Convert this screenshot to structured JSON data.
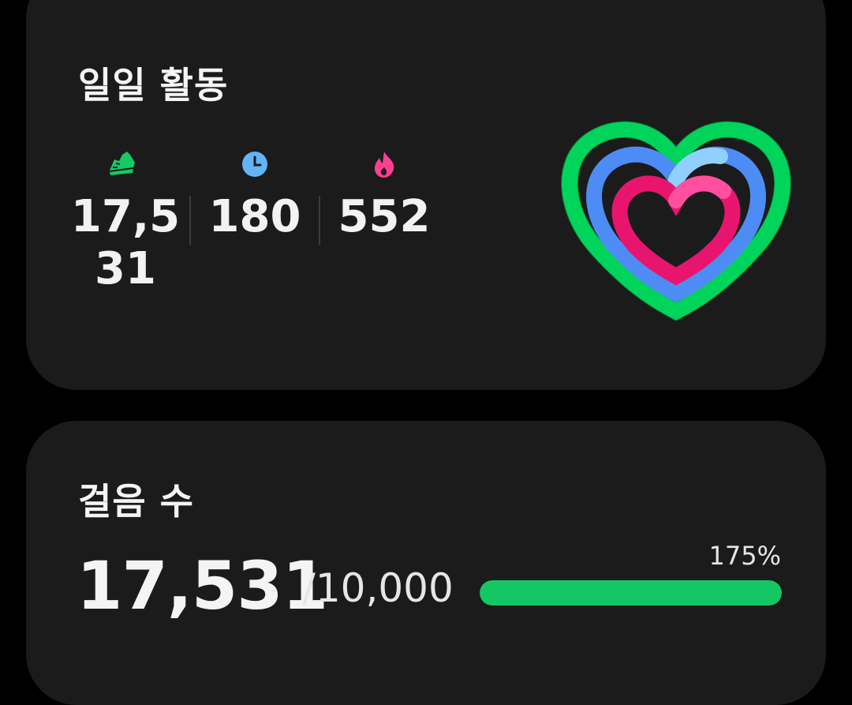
{
  "daily_activity": {
    "title": "일일 활동",
    "metrics": [
      {
        "icon": "shoe-icon",
        "value": "17,531",
        "color": "#17c964"
      },
      {
        "icon": "clock-icon",
        "value": "180",
        "color": "#63b3f5"
      },
      {
        "icon": "flame-icon",
        "value": "552",
        "color": "#ff3f8f"
      }
    ],
    "rings": {
      "outer_color": "#00d45a",
      "middle_color": "#4d8cf5",
      "inner_color": "#e8156e"
    }
  },
  "steps": {
    "title": "걸음 수",
    "value": "17,531",
    "goal": "/10,000",
    "percent_label": "175%",
    "progress_fraction": 1.0,
    "bar_color": "#13c864"
  }
}
